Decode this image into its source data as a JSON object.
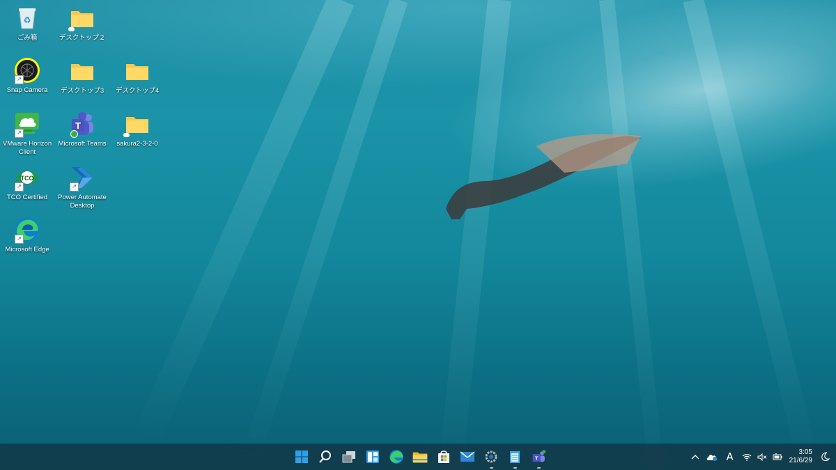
{
  "desktop": {
    "icons": [
      {
        "label": "ごみ箱",
        "icon": "recycle-bin-icon"
      },
      {
        "label": "デスクトップ２",
        "icon": "folder-icon"
      },
      {
        "label": "Snap Camera",
        "icon": "snap-camera-icon"
      },
      {
        "label": "デスクトップ3",
        "icon": "folder-icon"
      },
      {
        "label": "デスクトップ4",
        "icon": "folder-icon"
      },
      {
        "label": "VMware Horizon Client",
        "icon": "vmware-horizon-icon"
      },
      {
        "label": "Microsoft Teams",
        "icon": "teams-icon"
      },
      {
        "label": "sakura2-3-2-0",
        "icon": "folder-icon"
      },
      {
        "label": "TCO Certified",
        "icon": "tco-certified-icon"
      },
      {
        "label": "Power Automate Desktop",
        "icon": "power-automate-icon"
      },
      {
        "label": "Microsoft Edge",
        "icon": "edge-icon"
      }
    ]
  },
  "taskbar": {
    "apps": [
      {
        "name": "start-button",
        "icon": "windows-logo-icon"
      },
      {
        "name": "search-button",
        "icon": "search-icon"
      },
      {
        "name": "task-view-button",
        "icon": "task-view-icon"
      },
      {
        "name": "widgets-button",
        "icon": "widgets-icon"
      },
      {
        "name": "edge-taskbar-button",
        "icon": "edge-icon"
      },
      {
        "name": "file-explorer-button",
        "icon": "folder-icon"
      },
      {
        "name": "store-button",
        "icon": "store-icon"
      },
      {
        "name": "mail-button",
        "icon": "mail-icon"
      },
      {
        "name": "settings-button",
        "icon": "gear-icon"
      },
      {
        "name": "notepad-button",
        "icon": "notepad-icon"
      },
      {
        "name": "teams-taskbar-button",
        "icon": "teams-icon"
      }
    ],
    "tray": {
      "ime_mode": "A",
      "time": "3:05",
      "date": "21/6/29"
    }
  },
  "colors": {
    "folder": "#f7c948",
    "taskbar_bg": "#14374",
    "accent": "#0078d4"
  }
}
